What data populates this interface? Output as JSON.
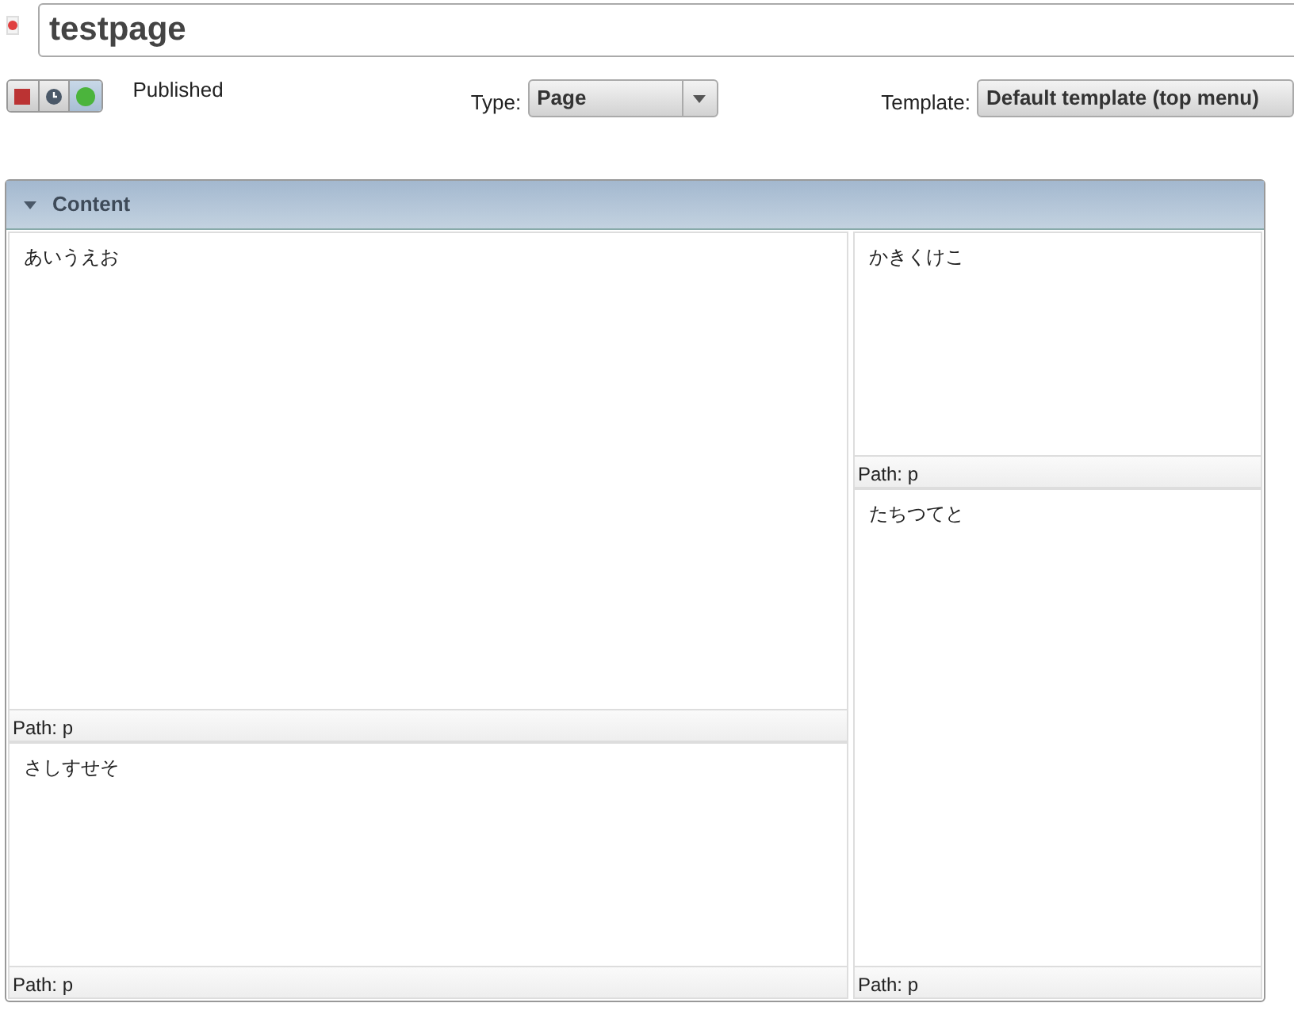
{
  "title_field": {
    "value": "testpage"
  },
  "status_buttons": [
    {
      "kind": "unpublished",
      "selected": false
    },
    {
      "kind": "scheduled",
      "selected": false
    },
    {
      "kind": "published",
      "selected": true
    }
  ],
  "status_label": "Published",
  "type_field": {
    "label": "Type:",
    "value": "Page"
  },
  "template_field": {
    "label": "Template:",
    "value": "Default template (top menu)"
  },
  "section": {
    "title": "Content",
    "expanded": true,
    "columns": [
      [
        {
          "text": "あいうえお",
          "path": "Path: p"
        },
        {
          "text": "さしすせそ",
          "path": "Path: p"
        }
      ],
      [
        {
          "text": "かきくけこ",
          "path": "Path: p"
        },
        {
          "text": "たちつてと",
          "path": "Path: p"
        }
      ]
    ]
  }
}
